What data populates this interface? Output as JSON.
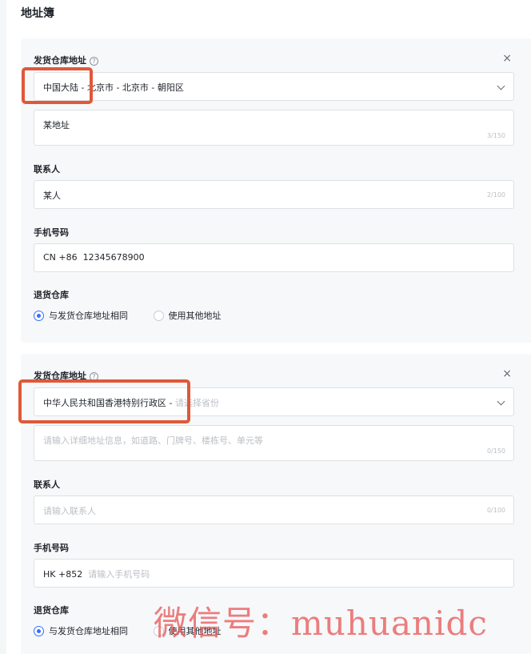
{
  "page_title": "地址簿",
  "cards": [
    {
      "ship_label": "发货仓库地址",
      "region_selected": "中国大陆 - 北京市 - 北京市 - 朝阳区",
      "region_placeholder": "",
      "address_value": "某地址",
      "address_counter": "3/150",
      "contact_label": "联系人",
      "contact_value": "某人",
      "contact_counter": "2/100",
      "phone_label": "手机号码",
      "phone_prefix": "CN +86",
      "phone_value": "12345678900",
      "return_label": "退货仓库",
      "option_same": "与发货仓库地址相同",
      "option_other": "使用其他地址"
    },
    {
      "ship_label": "发货仓库地址",
      "region_selected": "中华人民共和国香港特别行政区 -",
      "region_placeholder": "请选择省份",
      "address_placeholder": "请输入详细地址信息，如道路、门牌号、楼栋号、单元等",
      "address_counter": "0/150",
      "contact_label": "联系人",
      "contact_placeholder": "请输入联系人",
      "contact_counter": "0/100",
      "phone_label": "手机号码",
      "phone_prefix": "HK +852",
      "phone_placeholder": "请输入手机号码",
      "return_label": "退货仓库",
      "option_same": "与发货仓库地址相同",
      "option_other": "使用其他地址"
    }
  ],
  "icons": {
    "help": "?",
    "close": "×"
  },
  "watermark": "微信号：muhuanidc",
  "colors": {
    "accent": "#3370ff",
    "highlight": "#e0583a",
    "watermark": "#e85a5a"
  }
}
